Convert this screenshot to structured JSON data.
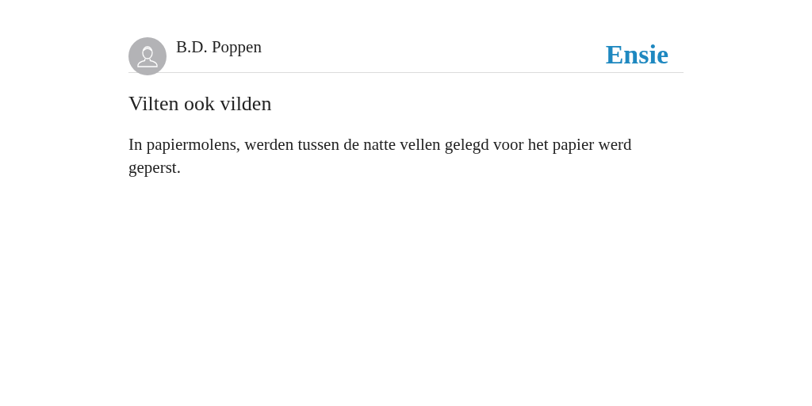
{
  "header": {
    "author": "B.D. Poppen",
    "logo": "Ensie"
  },
  "article": {
    "title": "Vilten ook vilden",
    "body": "In papiermolens, werden tussen de natte vellen gelegd voor het papier werd geperst."
  }
}
